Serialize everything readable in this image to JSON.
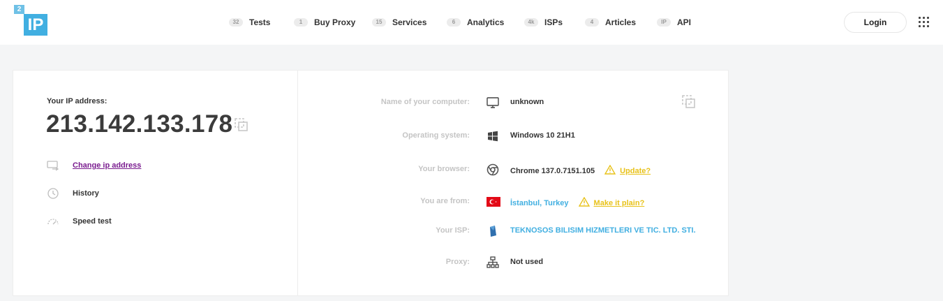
{
  "logo": {
    "small": "2",
    "big": "IP"
  },
  "nav": [
    {
      "badge": "32",
      "label": "Tests"
    },
    {
      "badge": "1",
      "label": "Buy Proxy"
    },
    {
      "badge": "15",
      "label": "Services"
    },
    {
      "badge": "6",
      "label": "Analytics"
    },
    {
      "badge": "4k",
      "label": "ISPs"
    },
    {
      "badge": "4",
      "label": "Articles"
    },
    {
      "badge": "IP",
      "label": "API"
    }
  ],
  "header": {
    "login_label": "Login"
  },
  "ip": {
    "label": "Your IP address:",
    "value": "213.142.133.178"
  },
  "links": {
    "change_ip": "Change ip address",
    "history": "History",
    "speed_test": "Speed test"
  },
  "info": {
    "computer": {
      "label": "Name of your computer:",
      "value": "unknown"
    },
    "os": {
      "label": "Operating system:",
      "value": "Windows 10 21H1"
    },
    "browser": {
      "label": "Your browser:",
      "value": "Chrome 137.0.7151.105",
      "warning": "Update?"
    },
    "location": {
      "label": "You are from:",
      "value": "İstanbul, Turkey",
      "warning": "Make it plain?"
    },
    "isp": {
      "label": "Your ISP:",
      "value": "TEKNOSOS BILISIM HIZMETLERI VE TIC. LTD. STI."
    },
    "proxy": {
      "label": "Proxy:",
      "value": "Not used"
    }
  },
  "colors": {
    "accent": "#41afe1",
    "warning": "#e8c21a",
    "link_visited": "#7a1c8f",
    "flag": "#e30a17"
  }
}
